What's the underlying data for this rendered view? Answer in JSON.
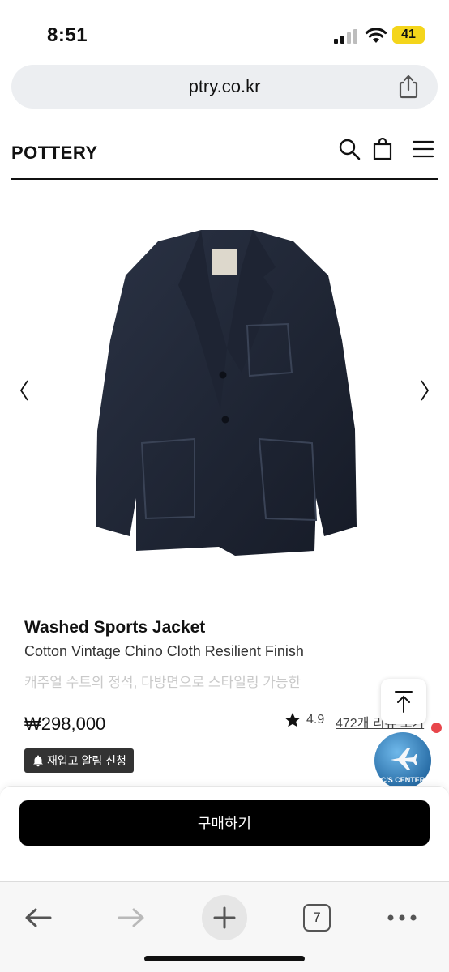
{
  "status_bar": {
    "time": "8:51",
    "battery": "41"
  },
  "browser": {
    "url": "ptry.co.kr",
    "tab_count": "7"
  },
  "site": {
    "logo": "POTTERY"
  },
  "product": {
    "title": "Washed Sports Jacket",
    "subtitle": "Cotton Vintage Chino Cloth Resilient Finish",
    "description": "캐주얼 수트의 정석, 다방면으로 스타일링 가능한",
    "price": "₩298,000",
    "rating": "4.9",
    "reviews": "472개 리뷰 보기",
    "restock_label": "재입고 알림 신청",
    "image_alt": "navy jacket"
  },
  "floating": {
    "cs_label": "C/S CENTER"
  },
  "buy": {
    "label": "구매하기"
  },
  "colors": {
    "accent": "#000000",
    "battery": "#f4d51b",
    "badge": "#333333",
    "notify_dot": "#e8464b"
  }
}
